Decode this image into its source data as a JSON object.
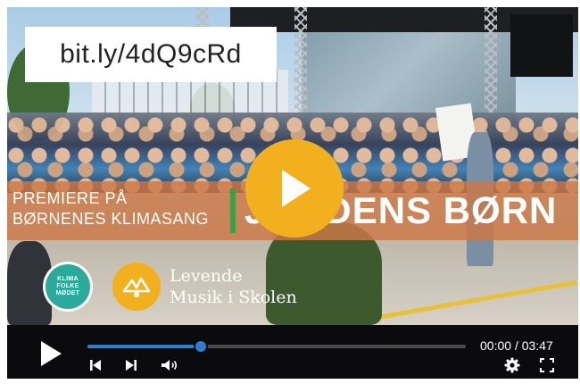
{
  "overlay": {
    "url": "bit.ly/4dQ9cRd"
  },
  "banner": {
    "subtitle_line1": "PREMIERE PÅ",
    "subtitle_line2": "BØRNENES KLIMASANG",
    "title": "JORDENS BØRN"
  },
  "logos": {
    "klima_line1": "KLIMA",
    "klima_line2": "FOLKE",
    "klima_line3": "MØDET",
    "lms_line1": "Levende",
    "lms_line2": "Musik i Skolen"
  },
  "player": {
    "current_time": "00:00",
    "separator": "/",
    "duration": "03:47",
    "progress": 0.3
  },
  "icons": {
    "big_play": "play-icon",
    "play": "play-icon",
    "previous": "skip-previous-icon",
    "next": "skip-next-icon",
    "volume": "volume-icon",
    "settings": "gear-icon",
    "fullscreen": "fullscreen-icon"
  },
  "colors": {
    "accent_play": "#f2b01e",
    "banner": "#cc7846",
    "divider": "#35a34a",
    "progress": "#2f7fd1",
    "control_bar": "#0b0b0d"
  }
}
